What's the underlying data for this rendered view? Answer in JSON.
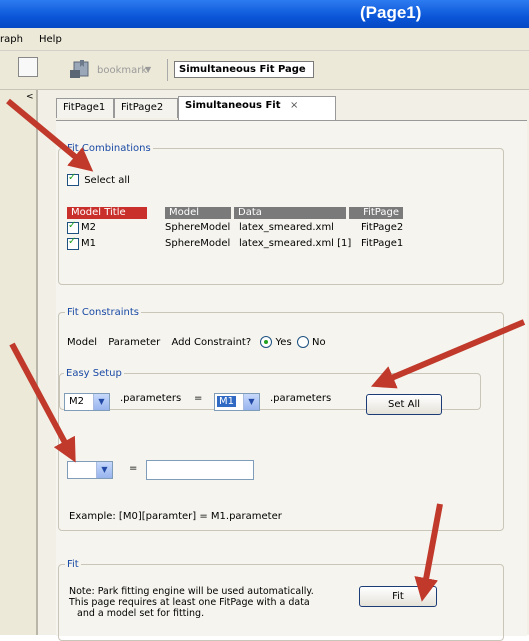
{
  "window": {
    "title": "(Page1)"
  },
  "menu": {
    "graph": "raph",
    "help": "Help"
  },
  "toolbar": {
    "bookmark": "bookmark",
    "page_title": "Simultaneous Fit Page"
  },
  "tabs": [
    {
      "label": "FitPage1"
    },
    {
      "label": "FitPage2"
    },
    {
      "label": "Simultaneous Fit",
      "close": "×"
    }
  ],
  "fit_combinations": {
    "legend": "Fit Combinations",
    "select_all": "Select all",
    "headers": {
      "model_title": "Model Title",
      "model": "Model",
      "data": "Data",
      "fitpage": "FitPage"
    },
    "rows": [
      {
        "title": "M2",
        "model": "SphereModel",
        "data": "latex_smeared.xml",
        "fitpage": "FitPage2"
      },
      {
        "title": "M1",
        "model": "SphereModel",
        "data": "latex_smeared.xml [1]",
        "fitpage": "FitPage1"
      }
    ]
  },
  "fit_constraints": {
    "legend": "Fit Constraints",
    "col_model": "Model",
    "col_parameter": "Parameter",
    "add_constraint": "Add Constraint?",
    "yes": "Yes",
    "no": "No",
    "easy_setup": {
      "legend": "Easy Setup",
      "left_model": "M2",
      "params_label_1": ".parameters",
      "equals": "=",
      "right_model": "M1",
      "params_label_2": ".parameters",
      "set_all": "Set All"
    },
    "constraint_equals": "=",
    "example": "Example: [M0][paramter] = M1.parameter"
  },
  "fit": {
    "legend": "Fit",
    "note_line1": "Note: Park fitting engine will be used automatically.",
    "note_line2": "This page requires at least one FitPage with a data",
    "note_line3": "and a model set for fitting.",
    "button": "Fit"
  },
  "colors": {
    "titlebar": "#0a56d8",
    "legend_text": "#1a4aa6",
    "header_red": "#c9302c",
    "header_gray": "#7a7a7a",
    "arrow": "#c0392b"
  }
}
